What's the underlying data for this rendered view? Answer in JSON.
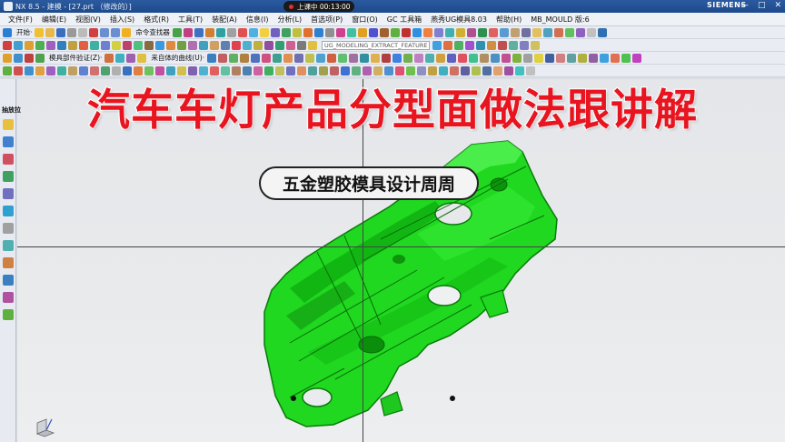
{
  "window": {
    "title": "NX 8.5 - 建模 - [27.prt （修改的）]",
    "recording_status": "上课中 00:13:00",
    "brand": "SIEMENS",
    "controls": [
      "—",
      "□",
      "✕"
    ]
  },
  "menubar": {
    "items": [
      "文件(F)",
      "编辑(E)",
      "视图(V)",
      "插入(S)",
      "格式(R)",
      "工具(T)",
      "装配(A)",
      "信息(I)",
      "分析(L)",
      "首选项(P)",
      "窗口(O)",
      "GC 工具箱",
      "燕秀UG模具8.03",
      "帮助(H)",
      "MB_MOULD 版:6"
    ]
  },
  "toolbars": {
    "start_label": "开始·",
    "command_finder": "命令查找器",
    "mold_validation": "模具部件验证(Z)·",
    "unlinked_curve": "来自体的曲线(U)·",
    "feature_field": "UG_MODELING_EXTRACT_FEATURE"
  },
  "viewport": {
    "panel_label": "抽放拉",
    "background": "#e6e8eb",
    "part_color": "#1fd81f"
  },
  "overlay": {
    "banner": "汽车车灯产品分型面做法跟讲解",
    "banner_color": "#e8141f",
    "subtitle": "五金塑胶模具设计周周"
  }
}
